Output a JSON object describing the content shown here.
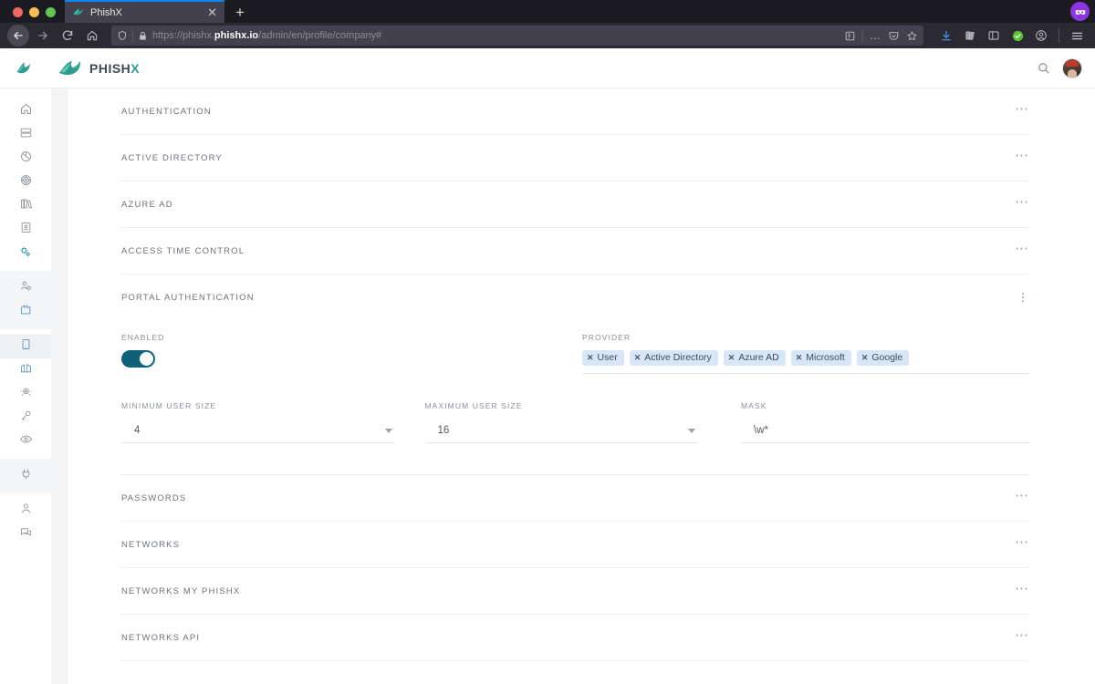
{
  "browser": {
    "tab": {
      "title": "PhishX",
      "favicon": "phishx-fish-icon",
      "close": "✕"
    },
    "newtab_label": "+",
    "url": {
      "prefix": "https://phishx.",
      "domain": "phishx.io",
      "path": "/admin/en/profile/company#"
    },
    "icons": {
      "back": "back-arrow-icon",
      "forward": "forward-arrow-icon",
      "reload": "reload-icon",
      "home": "home-icon",
      "shield": "tracking-protection-shield-icon",
      "lock": "padlock-icon",
      "reader": "reader-mode-icon",
      "page_actions": "…",
      "pocket": "pocket-icon",
      "bookmark": "star-bookmark-icon",
      "downloads": "download-arrow-icon",
      "library": "library-icon",
      "sidebar": "sidebar-toggle-icon",
      "protection_ok": "green-check-icon",
      "account": "account-circle-icon",
      "menu": "hamburger-menu-icon"
    }
  },
  "app": {
    "brand": {
      "name": "PHISH",
      "accent_letter": "X",
      "logo": "phishx-fish-logo"
    },
    "header_icons": {
      "search": "search-magnifier-icon",
      "avatar": "user-avatar"
    },
    "colors": {
      "accent_teal": "#2a9d9b",
      "toggle_on": "#0d6278",
      "chip_bg": "#d9e6f8",
      "kebab_blue": "#4f7fb3"
    }
  },
  "sidebar": {
    "groups": [
      {
        "shaded": false,
        "items": [
          {
            "name": "sidebar-item-home",
            "icon": "home-icon",
            "active": false
          },
          {
            "name": "sidebar-item-servers",
            "icon": "server-rack-icon",
            "active": false
          },
          {
            "name": "sidebar-item-analytics",
            "icon": "pie-chart-icon",
            "active": false
          },
          {
            "name": "sidebar-item-targets",
            "icon": "target-radar-icon",
            "active": false
          },
          {
            "name": "sidebar-item-library",
            "icon": "books-icon",
            "active": false
          },
          {
            "name": "sidebar-item-contacts",
            "icon": "contact-card-icon",
            "active": false
          },
          {
            "name": "sidebar-item-settings",
            "icon": "gears-icon",
            "active": true
          }
        ]
      },
      {
        "shaded": true,
        "items": [
          {
            "name": "sidebar-item-user-management",
            "icon": "user-gear-icon",
            "active": false
          },
          {
            "name": "sidebar-item-organization",
            "icon": "building-icon",
            "active": false
          }
        ]
      },
      {
        "shaded": false,
        "items": [
          {
            "name": "sidebar-item-company",
            "icon": "office-building-icon",
            "active": false,
            "selected": true
          },
          {
            "name": "sidebar-item-branches",
            "icon": "buildings-icon",
            "active": false
          },
          {
            "name": "sidebar-item-webcam",
            "icon": "webcam-icon",
            "active": false
          },
          {
            "name": "sidebar-item-keys",
            "icon": "key-icon",
            "active": false
          },
          {
            "name": "sidebar-item-visibility",
            "icon": "eye-icon",
            "active": false
          }
        ]
      },
      {
        "shaded": true,
        "items": [
          {
            "name": "sidebar-item-integrations",
            "icon": "plug-icon",
            "active": false
          }
        ]
      },
      {
        "shaded": false,
        "items": [
          {
            "name": "sidebar-item-profile",
            "icon": "person-icon",
            "active": false
          },
          {
            "name": "sidebar-item-messages",
            "icon": "chat-bubbles-icon",
            "active": false
          }
        ]
      }
    ]
  },
  "main": {
    "sections": [
      {
        "title": "Authentication",
        "menu": "⋯",
        "menu_type": "horizontal",
        "expanded": false
      },
      {
        "title": "Active Directory",
        "menu": "⋯",
        "menu_type": "horizontal",
        "expanded": false
      },
      {
        "title": "Azure AD",
        "menu": "⋯",
        "menu_type": "horizontal",
        "expanded": false
      },
      {
        "title": "Access Time Control",
        "menu": "⋯",
        "menu_type": "horizontal",
        "expanded": false
      },
      {
        "title": "Portal Authentication",
        "menu": "⋮",
        "menu_type": "vertical",
        "expanded": true
      },
      {
        "title": "Passwords",
        "menu": "⋯",
        "menu_type": "horizontal",
        "expanded": false
      },
      {
        "title": "Networks",
        "menu": "⋯",
        "menu_type": "horizontal",
        "expanded": false
      },
      {
        "title": "Networks My PhishX",
        "menu": "⋯",
        "menu_type": "horizontal",
        "expanded": false
      },
      {
        "title": "Networks API",
        "menu": "⋯",
        "menu_type": "horizontal",
        "expanded": false
      }
    ],
    "portal_authentication": {
      "enabled": {
        "label": "Enabled",
        "value": true
      },
      "provider": {
        "label": "Provider",
        "chips": [
          {
            "label": "User",
            "remove": "✕"
          },
          {
            "label": "Active Directory",
            "remove": "✕"
          },
          {
            "label": "Azure AD",
            "remove": "✕"
          },
          {
            "label": "Microsoft",
            "remove": "✕"
          },
          {
            "label": "Google",
            "remove": "✕"
          }
        ]
      },
      "minimum_user_size": {
        "label": "Minimum User Size",
        "value": "4"
      },
      "maximum_user_size": {
        "label": "Maximum User Size",
        "value": "16"
      },
      "mask": {
        "label": "Mask",
        "value": "\\w*"
      }
    }
  }
}
